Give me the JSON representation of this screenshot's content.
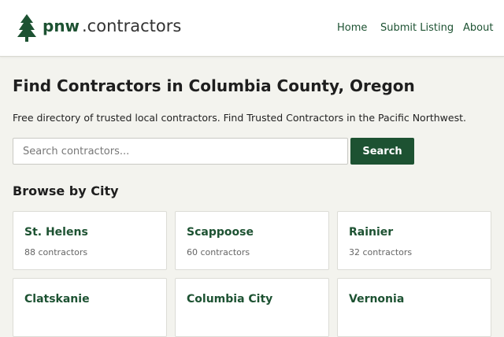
{
  "brand": {
    "name_bold": "pnw",
    "name_rest": " .contractors",
    "accent_color": "#1d5232"
  },
  "nav": {
    "items": [
      {
        "label": "Home"
      },
      {
        "label": "Submit Listing"
      },
      {
        "label": "About"
      }
    ]
  },
  "main": {
    "title": "Find Contractors in Columbia County, Oregon",
    "subtitle": "Free directory of trusted local contractors. Find Trusted Contractors in the Pacific Northwest.",
    "search": {
      "placeholder": "Search contractors...",
      "value": "",
      "button_label": "Search"
    },
    "browse_title": "Browse by City",
    "cities": [
      {
        "name": "St. Helens",
        "count": "88 contractors"
      },
      {
        "name": "Scappoose",
        "count": "60 contractors"
      },
      {
        "name": "Rainier",
        "count": "32 contractors"
      },
      {
        "name": "Clatskanie",
        "count": ""
      },
      {
        "name": "Columbia City",
        "count": ""
      },
      {
        "name": "Vernonia",
        "count": ""
      }
    ]
  },
  "icons": {
    "logo": "evergreen-tree-icon"
  }
}
